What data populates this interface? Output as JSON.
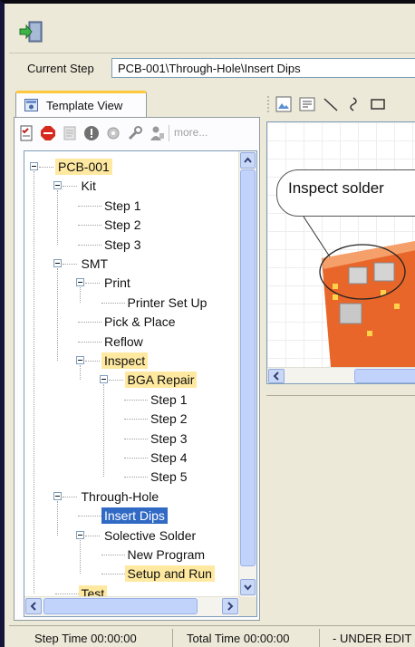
{
  "current_step": {
    "label": "Current Step",
    "value": "PCB-001\\Through-Hole\\Insert Dips"
  },
  "template_tab": {
    "label": "Template View",
    "icon": "template-view-icon"
  },
  "toolbar": {
    "more_label": "more..."
  },
  "tree": [
    {
      "label": "PCB-001",
      "state": "highlight"
    },
    {
      "label": "Kit"
    },
    {
      "label": "Step 1"
    },
    {
      "label": "Step 2"
    },
    {
      "label": "Step 3"
    },
    {
      "label": "SMT"
    },
    {
      "label": "Print"
    },
    {
      "label": "Printer Set Up"
    },
    {
      "label": "Pick & Place"
    },
    {
      "label": "Reflow"
    },
    {
      "label": "Inspect",
      "state": "highlight"
    },
    {
      "label": "BGA Repair",
      "state": "highlight"
    },
    {
      "label": "Step 1"
    },
    {
      "label": "Step 2"
    },
    {
      "label": "Step 3"
    },
    {
      "label": "Step 4"
    },
    {
      "label": "Step 5"
    },
    {
      "label": "Through-Hole"
    },
    {
      "label": "Insert Dips",
      "state": "selected"
    },
    {
      "label": "Solective Solder"
    },
    {
      "label": "New Program"
    },
    {
      "label": "Setup and Run",
      "state": "highlight"
    },
    {
      "label": "Test",
      "state": "highlight"
    }
  ],
  "canvas": {
    "callout_text": "Inspect solder"
  },
  "status": {
    "step_time": "Step Time 00:00:00",
    "total_time": "Total Time 00:00:00",
    "mode": "- UNDER EDIT"
  },
  "colors": {
    "highlight": "#ffe9a0",
    "selected": "#316ac5",
    "tab_accent": "#ffc83c"
  }
}
